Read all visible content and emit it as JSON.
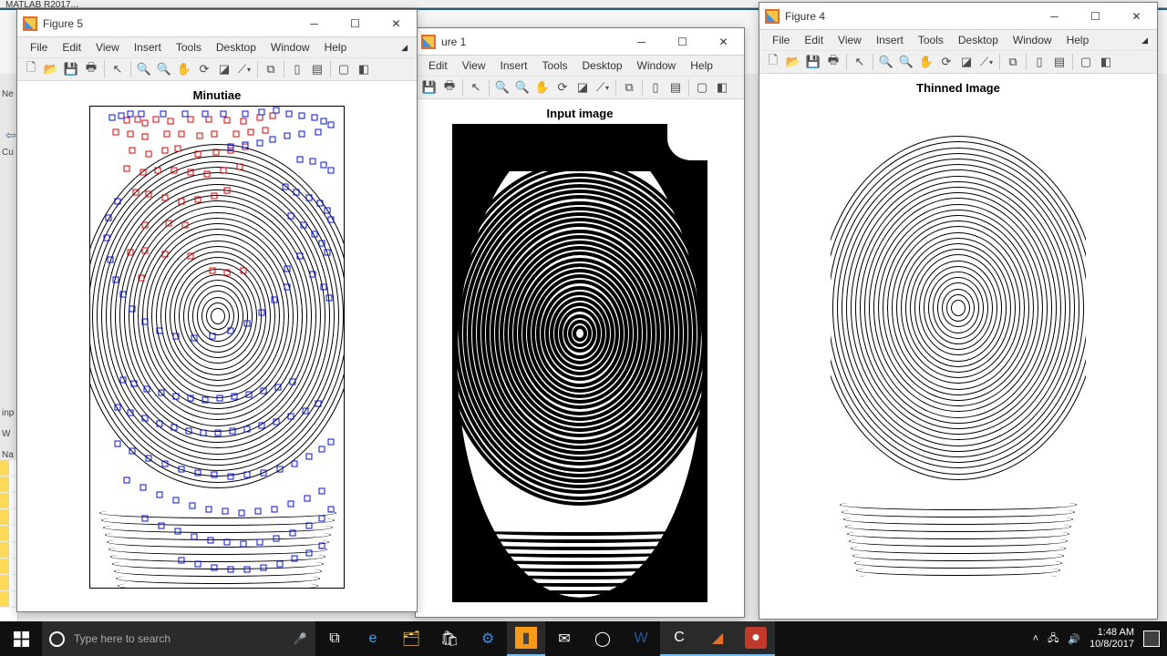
{
  "figures": {
    "fig5": {
      "title": "Figure 5",
      "plot_title": "Minutiae"
    },
    "fig1": {
      "title": "ure 1",
      "plot_title": "Input image"
    },
    "fig4": {
      "title": "Figure 4",
      "plot_title": "Thinned Image"
    }
  },
  "menus": {
    "file": "File",
    "edit": "Edit",
    "view": "View",
    "insert": "Insert",
    "tools": "Tools",
    "desktop": "Desktop",
    "window": "Window",
    "help": "Help"
  },
  "toolbar_icons": [
    "new-figure",
    "open",
    "save",
    "print",
    "sep",
    "pointer",
    "sep",
    "zoom-in",
    "zoom-out",
    "pan",
    "rotate3d",
    "data-cursor",
    "brush",
    "sep",
    "link",
    "sep",
    "colorbar",
    "legend",
    "sep",
    "hide-tools",
    "dock"
  ],
  "bg": {
    "app_title": "MATLAB R2017...",
    "nav_back": "⇦",
    "pane_labels": {
      "input": "inp",
      "workspace": "W",
      "name": "Na",
      "current": "Cu",
      "new": "Ne"
    }
  },
  "taskbar": {
    "search_placeholder": "Type here to search",
    "time": "1:48 AM",
    "date": "10/8/2017"
  },
  "chart_data": [
    {
      "type": "scatter",
      "title": "Minutiae",
      "description": "Thinned fingerprint ridge skeleton (concentric whorl) overlaid with detected minutiae. Red squares = ridge endings, Blue squares = bifurcations. Image coords, ~280×530 px plot.",
      "series": [
        {
          "name": "ridge-endings",
          "color": "#e00000",
          "marker": "square-open",
          "points_approx": [
            [
              40,
              15
            ],
            [
              52,
              14
            ],
            [
              60,
              18
            ],
            [
              72,
              14
            ],
            [
              88,
              16
            ],
            [
              110,
              14
            ],
            [
              130,
              14
            ],
            [
              150,
              15
            ],
            [
              168,
              16
            ],
            [
              186,
              12
            ],
            [
              200,
              10
            ],
            [
              28,
              28
            ],
            [
              44,
              30
            ],
            [
              60,
              33
            ],
            [
              84,
              30
            ],
            [
              100,
              30
            ],
            [
              120,
              32
            ],
            [
              136,
              30
            ],
            [
              160,
              30
            ],
            [
              176,
              28
            ],
            [
              192,
              26
            ],
            [
              46,
              48
            ],
            [
              64,
              52
            ],
            [
              82,
              48
            ],
            [
              96,
              46
            ],
            [
              118,
              52
            ],
            [
              138,
              50
            ],
            [
              154,
              48
            ],
            [
              170,
              44
            ],
            [
              40,
              68
            ],
            [
              58,
              72
            ],
            [
              74,
              70
            ],
            [
              92,
              70
            ],
            [
              110,
              72
            ],
            [
              128,
              74
            ],
            [
              146,
              70
            ],
            [
              164,
              66
            ],
            [
              50,
              94
            ],
            [
              64,
              96
            ],
            [
              82,
              100
            ],
            [
              100,
              104
            ],
            [
              118,
              102
            ],
            [
              136,
              98
            ],
            [
              150,
              92
            ],
            [
              60,
              130
            ],
            [
              86,
              128
            ],
            [
              104,
              130
            ],
            [
              44,
              160
            ],
            [
              60,
              158
            ],
            [
              82,
              162
            ],
            [
              110,
              164
            ],
            [
              134,
              180
            ],
            [
              150,
              182
            ],
            [
              168,
              180
            ],
            [
              56,
              188
            ]
          ]
        },
        {
          "name": "bifurcations",
          "color": "#0010e8",
          "marker": "square-open",
          "points_approx": [
            [
              24,
              12
            ],
            [
              34,
              10
            ],
            [
              44,
              8
            ],
            [
              56,
              8
            ],
            [
              80,
              8
            ],
            [
              104,
              8
            ],
            [
              126,
              8
            ],
            [
              146,
              8
            ],
            [
              170,
              8
            ],
            [
              188,
              6
            ],
            [
              204,
              4
            ],
            [
              218,
              8
            ],
            [
              232,
              10
            ],
            [
              246,
              12
            ],
            [
              256,
              16
            ],
            [
              264,
              20
            ],
            [
              250,
              28
            ],
            [
              232,
              30
            ],
            [
              216,
              32
            ],
            [
              200,
              36
            ],
            [
              186,
              40
            ],
            [
              170,
              42
            ],
            [
              154,
              44
            ],
            [
              230,
              58
            ],
            [
              244,
              60
            ],
            [
              256,
              64
            ],
            [
              264,
              70
            ],
            [
              214,
              88
            ],
            [
              226,
              94
            ],
            [
              240,
              100
            ],
            [
              252,
              106
            ],
            [
              260,
              114
            ],
            [
              264,
              124
            ],
            [
              220,
              120
            ],
            [
              234,
              130
            ],
            [
              246,
              140
            ],
            [
              254,
              150
            ],
            [
              260,
              160
            ],
            [
              230,
              164
            ],
            [
              216,
              178
            ],
            [
              244,
              184
            ],
            [
              256,
              198
            ],
            [
              262,
              210
            ],
            [
              30,
              104
            ],
            [
              20,
              122
            ],
            [
              18,
              144
            ],
            [
              22,
              168
            ],
            [
              28,
              190
            ],
            [
              36,
              206
            ],
            [
              46,
              222
            ],
            [
              60,
              236
            ],
            [
              76,
              246
            ],
            [
              94,
              252
            ],
            [
              114,
              254
            ],
            [
              134,
              252
            ],
            [
              154,
              246
            ],
            [
              172,
              238
            ],
            [
              188,
              226
            ],
            [
              202,
              212
            ],
            [
              216,
              198
            ],
            [
              36,
              300
            ],
            [
              48,
              304
            ],
            [
              62,
              310
            ],
            [
              78,
              314
            ],
            [
              94,
              318
            ],
            [
              110,
              320
            ],
            [
              126,
              322
            ],
            [
              142,
              320
            ],
            [
              158,
              318
            ],
            [
              174,
              316
            ],
            [
              190,
              312
            ],
            [
              206,
              308
            ],
            [
              222,
              302
            ],
            [
              30,
              330
            ],
            [
              44,
              336
            ],
            [
              60,
              342
            ],
            [
              76,
              348
            ],
            [
              92,
              352
            ],
            [
              108,
              356
            ],
            [
              124,
              358
            ],
            [
              140,
              358
            ],
            [
              156,
              356
            ],
            [
              172,
              354
            ],
            [
              188,
              350
            ],
            [
              204,
              346
            ],
            [
              220,
              340
            ],
            [
              236,
              334
            ],
            [
              250,
              326
            ],
            [
              30,
              370
            ],
            [
              46,
              378
            ],
            [
              64,
              386
            ],
            [
              82,
              392
            ],
            [
              100,
              398
            ],
            [
              118,
              402
            ],
            [
              136,
              404
            ],
            [
              154,
              406
            ],
            [
              172,
              404
            ],
            [
              190,
              402
            ],
            [
              208,
              398
            ],
            [
              224,
              392
            ],
            [
              240,
              384
            ],
            [
              254,
              376
            ],
            [
              264,
              368
            ],
            [
              40,
              410
            ],
            [
              58,
              418
            ],
            [
              76,
              426
            ],
            [
              94,
              432
            ],
            [
              112,
              438
            ],
            [
              130,
              442
            ],
            [
              148,
              444
            ],
            [
              166,
              446
            ],
            [
              184,
              444
            ],
            [
              202,
              442
            ],
            [
              220,
              436
            ],
            [
              238,
              430
            ],
            [
              254,
              422
            ],
            [
              60,
              452
            ],
            [
              78,
              460
            ],
            [
              96,
              466
            ],
            [
              114,
              472
            ],
            [
              132,
              476
            ],
            [
              150,
              478
            ],
            [
              168,
              480
            ],
            [
              186,
              478
            ],
            [
              204,
              474
            ],
            [
              222,
              468
            ],
            [
              240,
              460
            ],
            [
              254,
              452
            ],
            [
              264,
              442
            ],
            [
              100,
              498
            ],
            [
              118,
              502
            ],
            [
              136,
              506
            ],
            [
              154,
              508
            ],
            [
              172,
              508
            ],
            [
              190,
              506
            ],
            [
              208,
              502
            ],
            [
              224,
              496
            ],
            [
              240,
              490
            ],
            [
              254,
              482
            ]
          ]
        }
      ]
    },
    {
      "type": "other",
      "title": "Input image",
      "description": "Binarized fingerprint (black ridges on white), whorl pattern, ~280×525 px."
    },
    {
      "type": "other",
      "title": "Thinned Image",
      "description": "1-pixel-wide skeletonized ridges of same fingerprint, whorl pattern, ~280×525 px."
    }
  ]
}
